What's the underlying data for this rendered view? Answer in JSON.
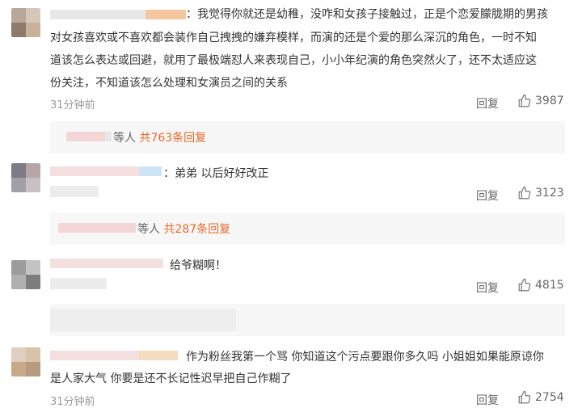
{
  "comments": [
    {
      "text_line1": "：我觉得你就还是幼稚，没咋和女孩子接触过，正是个恋爱朦胧期的男孩",
      "text_line2": "对女孩喜欢或不喜欢都会装作自己拽拽的嫌弃模样，而演的还是个爱的那么深沉的角色，一时不知",
      "text_line3": "道该怎么表达或回避，就用了最极端怼人来表现自己，小小年纪演的角色突然火了，还不太适应这",
      "text_line4": "份关注，不知道该怎么处理和女演员之间的关系",
      "time": "31分钟前",
      "reply": "回复",
      "likes": "3987",
      "sub_who": "等人",
      "sub_count": "共763条回复"
    },
    {
      "text_line1": "：弟弟 以后好好改正",
      "time": "",
      "reply": "回复",
      "likes": "3123",
      "sub_who": "等人",
      "sub_count": "共287条回复"
    },
    {
      "text_line1": "给爷糊啊！",
      "time": "",
      "reply": "回复",
      "likes": "4815"
    },
    {
      "text_line1": "作为粉丝我第一个骂 你知道这个污点要跟你多久吗 小姐姐如果能原谅你",
      "text_line2": "是人家大气 你要是还不长记性迟早把自己作糊了",
      "time": "31分钟前",
      "reply": "回复",
      "likes": "2754"
    }
  ]
}
